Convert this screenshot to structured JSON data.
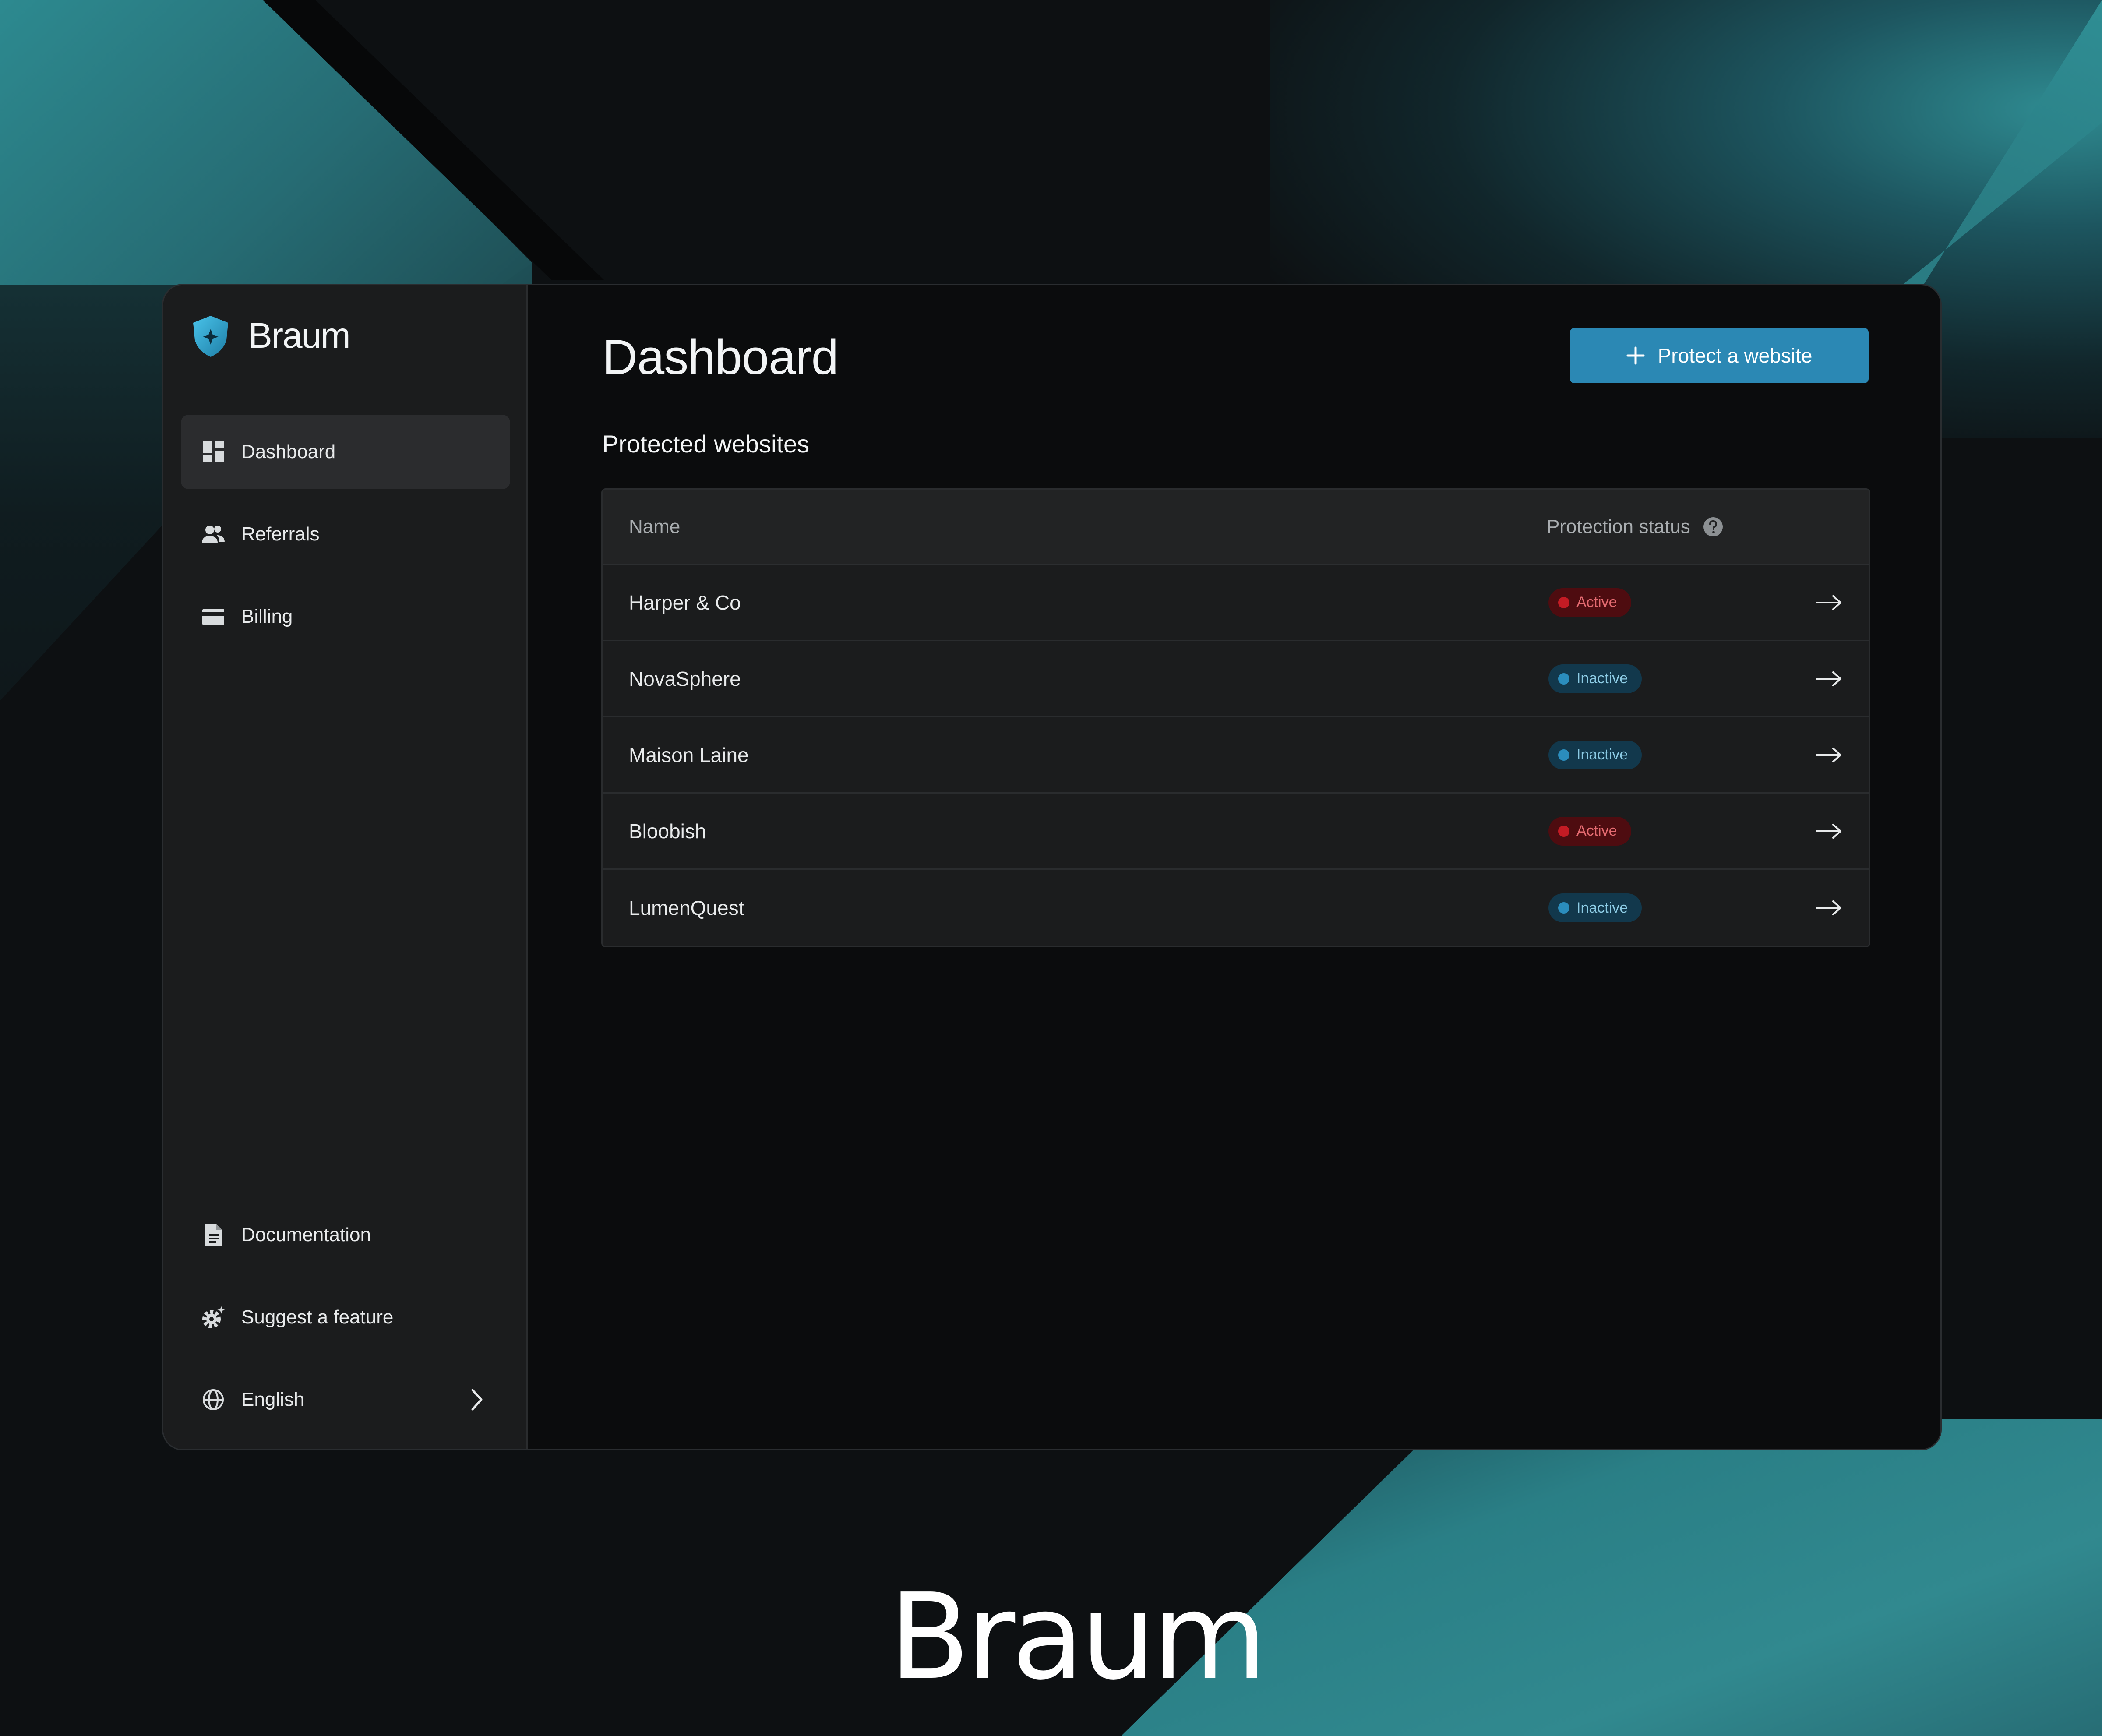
{
  "brand": {
    "name": "Braum",
    "accent": "#2b88b4"
  },
  "sidebar": {
    "items": [
      {
        "label": "Dashboard",
        "icon": "dashboard-icon",
        "active": true
      },
      {
        "label": "Referrals",
        "icon": "people-icon"
      },
      {
        "label": "Billing",
        "icon": "credit-card-icon"
      }
    ],
    "bottom": [
      {
        "label": "Documentation",
        "icon": "document-icon"
      },
      {
        "label": "Suggest a feature",
        "icon": "gear-sparkle-icon"
      },
      {
        "label": "English",
        "icon": "globe-icon",
        "chevron": "chevron-right-icon"
      }
    ]
  },
  "main": {
    "title": "Dashboard",
    "primary_button": "Protect a website",
    "section_title": "Protected websites",
    "table": {
      "columns": [
        "Name",
        "Protection status"
      ],
      "rows": [
        {
          "name": "Harper & Co",
          "status": "Active"
        },
        {
          "name": "NovaSphere",
          "status": "Inactive"
        },
        {
          "name": "Maison Laine",
          "status": "Inactive"
        },
        {
          "name": "Bloobish",
          "status": "Active"
        },
        {
          "name": "LumenQuest",
          "status": "Inactive"
        }
      ]
    }
  },
  "footer": {
    "logo_text": "Braum"
  },
  "colors": {
    "active_badge_bg": "#4e0c10",
    "active_badge_dot": "#c41b24",
    "inactive_badge_bg": "#12384c",
    "inactive_badge_dot": "#2b8dbd",
    "background_teal": "#2e8d93"
  }
}
